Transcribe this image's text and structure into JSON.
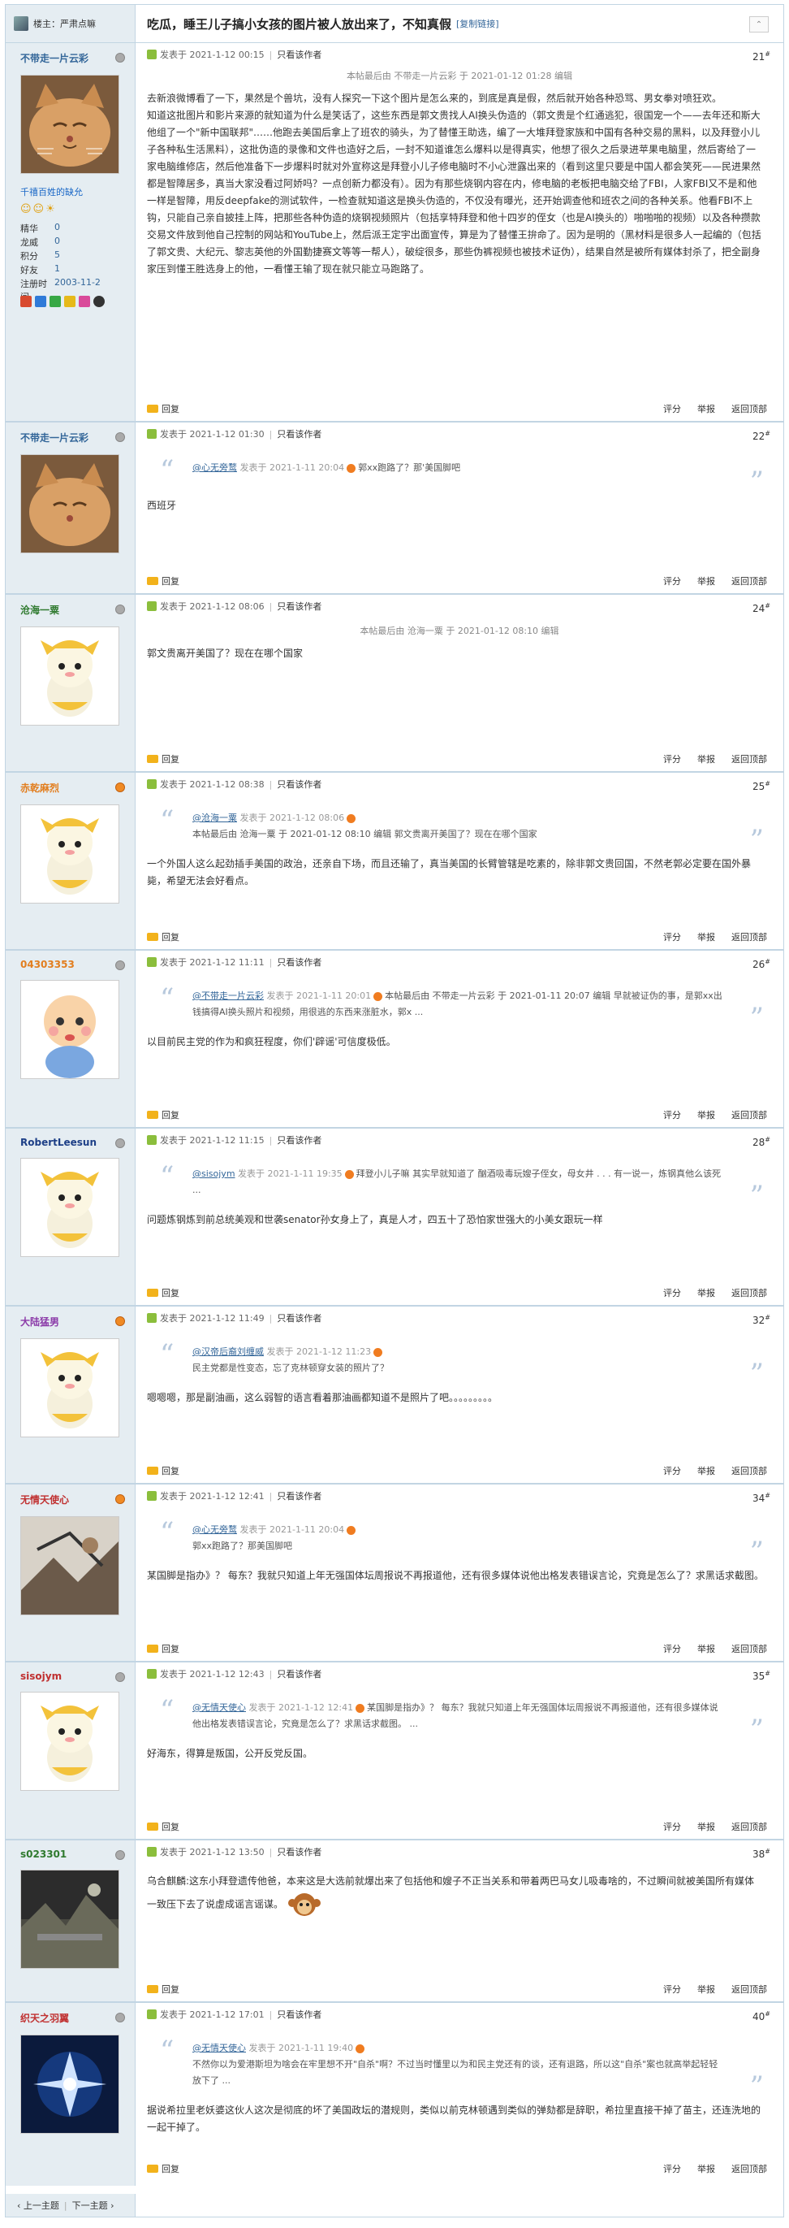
{
  "header": {
    "left_label": "楼主：严肃点嘛",
    "title": "吃瓜，睡王儿子搞小女孩的图片被人放出来了，不知真假",
    "copy_link": "[复制链接]"
  },
  "posts": [
    {
      "user": "不带走一片云彩",
      "group": "千禧百姓的缺允",
      "stats": [
        {
          "k": "精华",
          "v": "0"
        },
        {
          "k": "龙威",
          "v": "0"
        },
        {
          "k": "积分",
          "v": "5"
        },
        {
          "k": "好友",
          "v": "1"
        },
        {
          "k": "注册时间",
          "v": "2003-11-2"
        }
      ],
      "time": "发表于 2021-1-12 00:15",
      "only": "只看该作者",
      "floor": "21",
      "edited": "本帖最后由 不带走一片云彩 于 2021-01-12 01:28 编辑",
      "paragraphs": [
        "去新浪微博看了一下，果然是个兽坑，没有人探究一下这个图片是怎么来的，到底是真是假，然后就开始各种恐骂、男女拳对喷狂欢。",
        "知道这批图片和影片来源的就知道为什么是笑话了，这些东西是郭文贵找人AI换头伪造的（郭文贵是个红通逃犯，很国宠一个——去年还和斯大他组了一个\"新中国联邦\"……他跑去美国后拿上了班农的骑头，为了替懂王助选，编了一大堆拜登家族和中国有各种交易的黑料，以及拜登小儿子各种私生活黑料），这批伪造的录像和文件也造好之后，一封不知道谁怎么爆料以是得真实，他想了很久之后录进苹果电脑里，然后寄给了一家电脑维修店，然后他准备下一步爆料时就对外宣称这是拜登小儿子修电脑时不小心泄露出来的（看到这里只要是中国人都会笑死——民进果然都是智障居多，真当大家没看过阿娇吗？一点创新力都没有）。因为有那些烧钢内容在内，修电脑的老板把电脑交给了FBI，人家FBI又不是和他一样是智障，用反deepfake的测试软件，一检查就知道这是换头伪造的，不仅没有曝光，还开始调查他和班农之间的各种关系。他看FBI不上钩，只能自己亲自披挂上阵，把那些各种伪造的烧钢视频照片（包括享特拜登和他十四岁的侄女（也是AI换头的）啪啪啪的视频）以及各种攒款交易文件放到他自己控制的网站和YouTube上，然后派王定宇出面宣传，算是为了替懂王拚命了。因为是明的（黑材料是很多人一起编的（包括了郭文贵、大纪元、黎志英他的外国勤捷赛文等等一帮人），破绽很多，那些伪裤视频也被技术证伪），结果自然是被所有媒体封杀了，把全副身家压到懂王胜选身上的他，一看懂王输了现在就只能立马跑路了。"
      ]
    },
    {
      "user": "不带走一片云彩",
      "time": "发表于 2021-1-12 01:30",
      "only": "只看该作者",
      "floor": "22",
      "quote": {
        "user": "@心无旁鹜",
        "time": "发表于 2021-1-11 20:04",
        "text": "郭xx跑路了？那'美国脚吧"
      },
      "paragraphs": [
        "西班牙"
      ]
    },
    {
      "user": "沧海一粟",
      "time": "发表于 2021-1-12 08:06",
      "only": "只看该作者",
      "floor": "24",
      "edited": "本帖最后由 沧海一粟 于 2021-01-12 08:10 编辑",
      "paragraphs": [
        "郭文贵离开美国了？现在在哪个国家"
      ]
    },
    {
      "user": "赤乾麻烈",
      "time": "发表于 2021-1-12 08:38",
      "only": "只看该作者",
      "floor": "25",
      "quote": {
        "user": "@沧海一粟",
        "time": "发表于 2021-1-12 08:06",
        "text": "本帖最后由 沧海一粟 于 2021-01-12 08:10 编辑 郭文贵离开美国了？现在在哪个国家"
      },
      "paragraphs": [
        "一个外国人这么起劲插手美国的政治，还亲自下场，而且还输了，真当美国的长臂管辖是吃素的，除非郭文贵回国，不然老郭必定要在国外暴毙，希望无法会好看点。"
      ]
    },
    {
      "user": "04303353",
      "time": "发表于 2021-1-12 11:11",
      "only": "只看该作者",
      "floor": "26",
      "quote": {
        "user": "@不带走一片云彩",
        "time": "发表于 2021-1-11 20:01",
        "text": "本帖最后由 不带走一片云彩 于 2021-01-11 20:07 编辑 早就被证伪的事，是郭xx出钱搞得AI换头照片和视频，用很逃的东西来涨脏水，郭x ..."
      },
      "paragraphs": [
        "以目前民主党的作为和疯狂程度，你们'辟谣'可信度极低。"
      ]
    },
    {
      "user": "RobertLeesun",
      "time": "发表于 2021-1-12 11:15",
      "only": "只看该作者",
      "floor": "28",
      "quote": {
        "user": "@sisojym",
        "time": "发表于 2021-1-11 19:35",
        "text": "拜登小儿子嘛 其实早就知道了 酗酒吸毒玩嫂子侄女，母女井 . . . 有一说一，炼钢真他么该死 ..."
      },
      "paragraphs": [
        "问题炼钢炼到前总统美观和世袭senator孙女身上了，真是人才，四五十了恐怕家世强大的小美女跟玩一样"
      ]
    },
    {
      "user": "大陆猛男",
      "time": "发表于 2021-1-12 11:49",
      "only": "只看该作者",
      "floor": "32",
      "quote": {
        "user": "@汉帝后裔刘缠威",
        "time": "发表于 2021-1-12 11:23",
        "text": "民主党都是性变态，忘了克林顿穿女装的照片了？"
      },
      "paragraphs": [
        "嗯嗯嗯，那是副油画，这么弱智的语言看着那油画都知道不是照片了吧。。。。。。。。。"
      ]
    },
    {
      "user": "无情天使心",
      "time": "发表于 2021-1-12 12:41",
      "only": "只看该作者",
      "floor": "34",
      "quote": {
        "user": "@心无旁鹜",
        "time": "发表于 2021-1-11 20:04",
        "text": "郭xx跑路了？那美国脚吧"
      },
      "paragraphs": [
        "某国脚是指办》？ 每东？我就只知道上年无强国体坛周报说不再报道他，还有很多媒体说他出格发表错误言论，究竟是怎么了？求黑话求截图。"
      ]
    },
    {
      "user": "sisojym",
      "time": "发表于 2021-1-12 12:43",
      "only": "只看该作者",
      "floor": "35",
      "quote": {
        "user": "@无情天使心",
        "time": "发表于 2021-1-12 12:41",
        "text": "某国脚是指办》？ 每东？我就只知道上年无强国体坛周报说不再报道他，还有很多媒体说他出格发表错误言论，究竟是怎么了？求黑话求截图。 ..."
      },
      "paragraphs": [
        "好海东，得算是叛国，公开反党反国。"
      ]
    },
    {
      "user": "s023301",
      "time": "发表于 2021-1-12 13:50",
      "only": "只看该作者",
      "floor": "38",
      "paragraphs": [
        "乌合麒麟:这东小拜登遗传他爸，本来这是大选前就爆出来了包括他和嫂子不正当关系和带着两巴马女儿吸毒啥的，不过瞬间就被美国所有媒体一致压下去了说虚成谣言谣谋。"
      ]
    },
    {
      "user": "织天之羽翼",
      "time": "发表于 2021-1-12 17:01",
      "only": "只看该作者",
      "floor": "40",
      "quote": {
        "user": "@无情天使心",
        "time": "发表于 2021-1-11 19:40",
        "text": "不然你以为爱港斯坦为啥会在牢里想不开\"自杀\"啊？不过当时懂里以为和民主党还有的谈，还有退路，所以这\"自杀\"案也就高举起轻轻放下了 ..."
      },
      "paragraphs": [
        "据说希拉里老妖婆这伙人这次是彻底的坏了美国政坛的潜规则，类似以前克林顿遇到类似的弹劾都是辞职，希拉里直接干掉了苗主，还连洗地的一起干掉了。"
      ]
    }
  ],
  "footer_actions": {
    "rate": "评分",
    "report": "举报",
    "top": "返回顶部",
    "reply": "回复"
  },
  "bottom_nav": {
    "prev": "上一主题",
    "next": "下一主题"
  }
}
